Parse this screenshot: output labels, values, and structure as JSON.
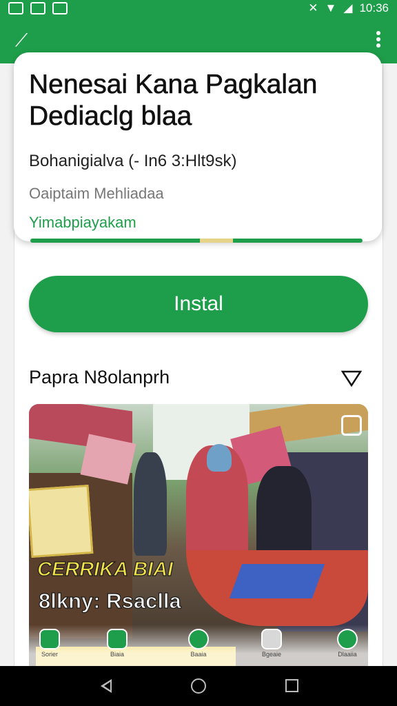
{
  "status_bar": {
    "time": "10:36"
  },
  "card": {
    "title": "Nenesai Kana Pagkalan Dediaclg blaa",
    "subtitle": "Bohanigialva (- In6 3:Hlt9sk)",
    "meta": "Oaiptaim Mehliadaa",
    "tagline": "Yimabpiayakam",
    "progress": 0.55
  },
  "install_label": "Instal",
  "section_label": "Papra N8olanprh",
  "hero": {
    "title": "CERRIKA BIAI",
    "subtitle": "8lkny: Rsaclla"
  },
  "bottom_nav": [
    {
      "label": "Sorier",
      "icon": "home-icon"
    },
    {
      "label": "Biaia",
      "icon": "bag-icon"
    },
    {
      "label": "Baaia",
      "icon": "apps-icon"
    },
    {
      "label": "Bgeaie",
      "icon": "profile-icon"
    },
    {
      "label": "Dlaaiia",
      "icon": "clock-icon"
    }
  ],
  "colors": {
    "accent": "#1e9e4a",
    "progress_mark": "#e6d38a",
    "hero_title": "#f2e24a"
  }
}
